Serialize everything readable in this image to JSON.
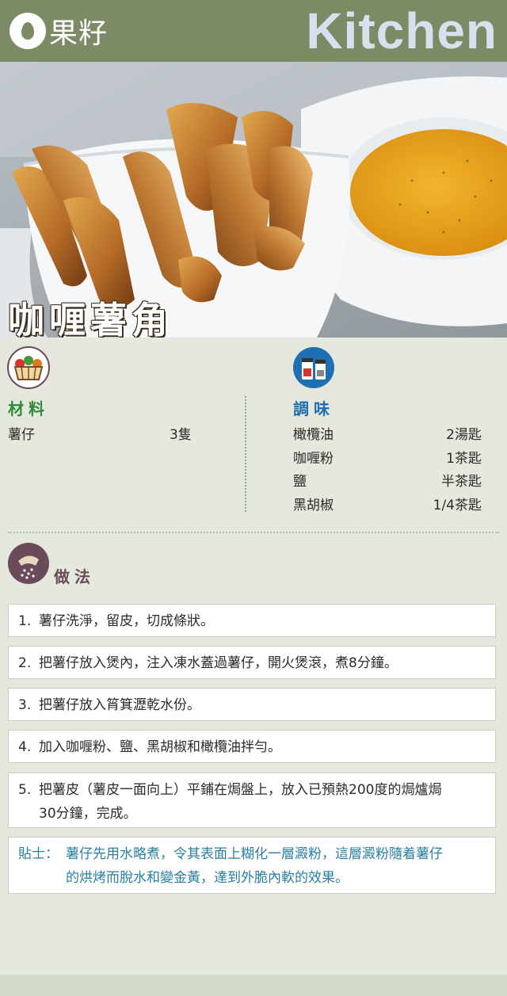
{
  "header": {
    "logo_text": "果籽",
    "brand": "Kitchen"
  },
  "dish": {
    "title": "咖喱薯角"
  },
  "ingredients": {
    "heading": "材料",
    "icon": "vegetable-basket-icon",
    "items": [
      {
        "name": "薯仔",
        "qty": "3隻"
      }
    ]
  },
  "seasoning": {
    "heading": "調味",
    "icon": "spice-jars-icon",
    "items": [
      {
        "name": "橄欖油",
        "qty": "2湯匙"
      },
      {
        "name": "咖喱粉",
        "qty": "1茶匙"
      },
      {
        "name": "鹽",
        "qty": "半茶匙"
      },
      {
        "name": "黑胡椒",
        "qty": "1/4茶匙"
      }
    ]
  },
  "method": {
    "heading": "做法",
    "icon": "seasoning-shaker-icon",
    "steps": [
      {
        "num": "1.",
        "text": "薯仔洗淨，留皮，切成條狀。"
      },
      {
        "num": "2.",
        "text": "把薯仔放入煲內，注入凍水蓋過薯仔，開火煲滾，煮8分鐘。"
      },
      {
        "num": "3.",
        "text": "把薯仔放入筲箕瀝乾水份。"
      },
      {
        "num": "4.",
        "text": "加入咖喱粉、鹽、黑胡椒和橄欖油拌勻。"
      },
      {
        "num": "5.",
        "line1": "把薯皮（薯皮一面向上）平鋪在焗盤上，放入已預熱200度的焗爐焗",
        "line2": "30分鐘，完成。"
      }
    ]
  },
  "tip": {
    "label": "貼士：",
    "line1": "薯仔先用水略煮，令其表面上糊化一層澱粉，這層澱粉隨着薯仔",
    "line2": "的烘烤而脫水和變金黃，達到外脆內軟的效果。"
  },
  "colors": {
    "header_bg": "#7c8b66",
    "ingredient_heading": "#2f8a3a",
    "seasoning_heading": "#1f6fb3",
    "method_heading": "#6b4a5a",
    "tip_text": "#2a7fa0"
  }
}
